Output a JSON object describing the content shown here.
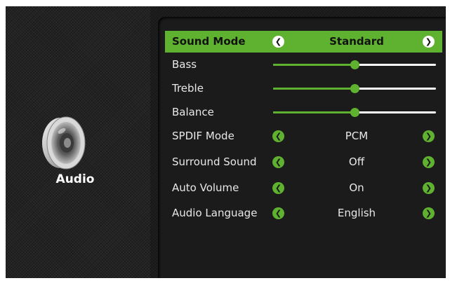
{
  "section": {
    "label": "Audio",
    "icon": "speaker-icon"
  },
  "colors": {
    "accent": "#5fb230",
    "panel": "#1b1b1b",
    "text": "#e8e8e8"
  },
  "menu": {
    "sound_mode": {
      "label": "Sound Mode",
      "value": "Standard"
    },
    "bass": {
      "label": "Bass",
      "level": 0.5
    },
    "treble": {
      "label": "Treble",
      "level": 0.5
    },
    "balance": {
      "label": "Balance",
      "level": 0.5
    },
    "spdif_mode": {
      "label": "SPDIF Mode",
      "value": "PCM"
    },
    "surround_sound": {
      "label": "Surround Sound",
      "value": "Off"
    },
    "auto_volume": {
      "label": "Auto Volume",
      "value": "On"
    },
    "audio_language": {
      "label": "Audio Language",
      "value": "English"
    }
  }
}
